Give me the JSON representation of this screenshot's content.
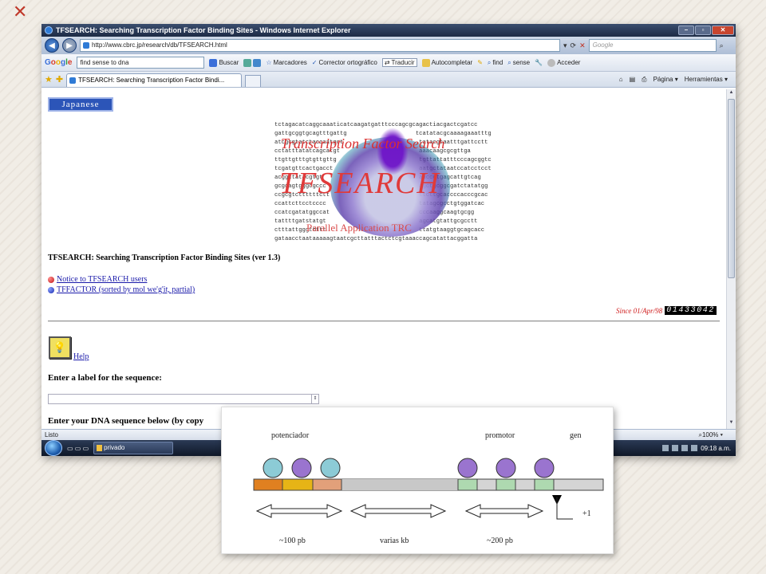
{
  "browser": {
    "window_title": "TFSEARCH: Searching Transcription Factor Binding Sites - Windows Internet Explorer",
    "url": "http://www.cbrc.jp/research/db/TFSEARCH.html",
    "search_placeholder": "Google",
    "tab_title": "TFSEARCH: Searching Transcription Factor Bindi...",
    "command_bar": {
      "page_label": "Página",
      "tools_label": "Herramientas"
    }
  },
  "google_toolbar": {
    "search_value": "find sense to dna",
    "search_label": "Buscar",
    "bookmarks_label": "Marcadores",
    "spellcheck_label": "Corrector ortográfico",
    "translate_label": "Traducir",
    "autofill_label": "Autocompletar",
    "find_label": "find",
    "sense_label": "sense",
    "signin_label": "Acceder"
  },
  "page": {
    "japanese_button": "Japanese",
    "logo": {
      "seq_lines": [
        "tctagacatcaggcaaaticatcaagatgatttcccagcgcagactiacgactcgatcc",
        "gattgcggtgcagtttgattg                    tcatatacgcaaaagaaatttga",
        "atcgcgtatctaccaatgct                      tatacgtaatttgattcctt",
        "cctatttatatcagcatgt                       aaacaagcgcgttga",
        "ttgttgtttgtgttgttg                        tgttattatttcccagcggtcg",
        "tcgatgttcactgacct                         aatgctataatccatcctcctag",
        "acggctatacgtgt                            aaccctgagcattgtcag",
        "gcgcagtgggcgccc                           agctgcggcgatctatatgg",
        "ccgcgtcttttttctt                          ttcttgcaccccacccgcac",
        "ccattcttcctcccc                           tatagcgcctgtggatcac",
        "ccatcgatatggccat                          cccaaggcaagtgcgg",
        "tattttgatstatgt                           agcatgtattgcgcctt",
        "ctttattgggttttt                           ttatgtaaggtgcagcacc",
        "gataacctaataaaaagtaatcgcttatttactctcgtaaaccagcatattacggatta"
      ],
      "title_small": "Transcription Factor Search",
      "title_big": "TFSEARCH",
      "subtitle": "Parallel Application TRC"
    },
    "heading": "TFSEARCH: Searching Transcription Factor Binding Sites (ver 1.3)",
    "links": [
      {
        "text": "Notice to TFSEARCH users",
        "bullet": "#c01818"
      },
      {
        "text": "TFFACTOR (sorted by mol we'g'it, partial)",
        "bullet": "#1a2bb0"
      }
    ],
    "since_text": "Since 01/Apr/98",
    "counter": "01433042",
    "help_label": "Help",
    "label_prompt": "Enter a label for the sequence:",
    "dna_prompt": "Enter your DNA sequence below (by copy"
  },
  "status_bar": {
    "status": "Listo",
    "zoom": "100%"
  },
  "taskbar": {
    "window_button": "privado",
    "clock": "09:18 a.m."
  },
  "diagram": {
    "labels": {
      "enhancer": "potenciador",
      "promoter": "promotor",
      "gene": "gen"
    },
    "distances": [
      "~100 pb",
      "varias kb",
      "~200 pb"
    ],
    "tss": "+1"
  }
}
